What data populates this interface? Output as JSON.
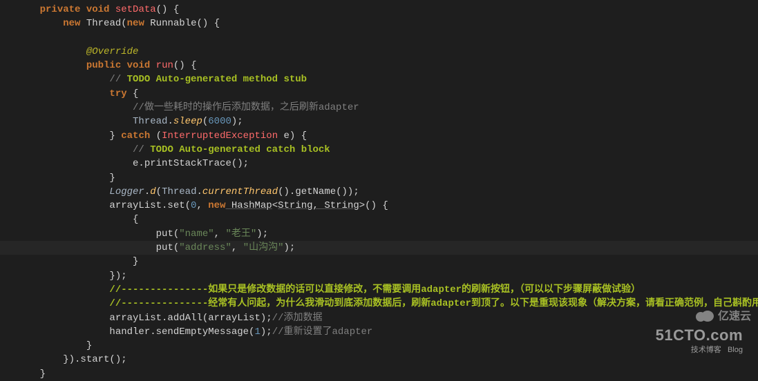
{
  "code": {
    "l1_private": "private",
    "l1_void": "void",
    "l1_method": "setData",
    "l1_tail": "() {",
    "l2_new1": "new",
    "l2_thread": "Thread(",
    "l2_new2": "new",
    "l2_run": "Runnable() {",
    "l3_override": "@Override",
    "l4_pub": "public",
    "l4_void": "void",
    "l4_run": "run",
    "l4_tail": "() {",
    "l5_c1": "// ",
    "l5_todo": "TODO",
    "l5_rest": " Auto-generated method stub",
    "l6_try": "try",
    "l6_brace": " {",
    "l7_c": "//做一些耗时的操作后添加数据，之后刷新adapter",
    "l8_thread": "Thread",
    "l8_dot": ".",
    "l8_sleep": "sleep",
    "l8_p1": "(",
    "l8_num": "6000",
    "l8_p2": ");",
    "l9_brace": "} ",
    "l9_catch": "catch",
    "l9_p1": " (",
    "l9_exc": "InterruptedException",
    "l9_e": " e) {",
    "l10_c1": "// ",
    "l10_todo": "TODO",
    "l10_rest": " Auto-generated catch block",
    "l11_e": "e.printStackTrace();",
    "l12_brace": "}",
    "l13_logger": "Logger",
    "l13_dot": ".",
    "l13_d": "d",
    "l13_p1": "(",
    "l13_thread": "Thread",
    "l13_dot2": ".",
    "l13_ct": "currentThread",
    "l13_p2": "().getName());",
    "l14_al": "arrayList.set(",
    "l14_zero": "0",
    "l14_mid": ", ",
    "l14_new": "new",
    "l14_hm": " HashMap",
    "l14_gen1": "<",
    "l14_s1": "String",
    "l14_comma": ", ",
    "l14_s2": "String",
    "l14_gen2": ">",
    "l14_tail": "() {",
    "l15_brace": "{",
    "l16_put": "put(",
    "l16_s1": "\"name\"",
    "l16_c": ", ",
    "l16_s2": "\"老王\"",
    "l16_e": ");",
    "l17_put": "put(",
    "l17_s1": "\"address\"",
    "l17_c": ", ",
    "l17_s2": "\"山沟沟\"",
    "l17_e": ");",
    "l18_brace": "}",
    "l19_close": "});",
    "l20_c": "//---------------如果只是修改数据的话可以直接修改，不需要调用adapter的刷新按钮，（可以以下步骤屏蔽做试验）",
    "l21_c": "//---------------经常有人问起，为什么我滑动到底添加数据后，刷新adapter到顶了。以下是重现该现象（解决方案，请看正确范例，自己斟酌用哪种方案）",
    "l22_a": "arrayList.addAll(arrayList);",
    "l22_c": "//添加数据",
    "l23_a": "handler.sendEmptyMessage(",
    "l23_n": "1",
    "l23_b": ");",
    "l23_c": "//重新设置了adapter",
    "l24_brace": "}",
    "l25_close": "}).start();",
    "l26_brace": "}"
  },
  "watermark1_big": "51CTO.com",
  "watermark1_small1": "技术博客",
  "watermark1_small2": "Blog",
  "watermark2_text": "亿速云"
}
